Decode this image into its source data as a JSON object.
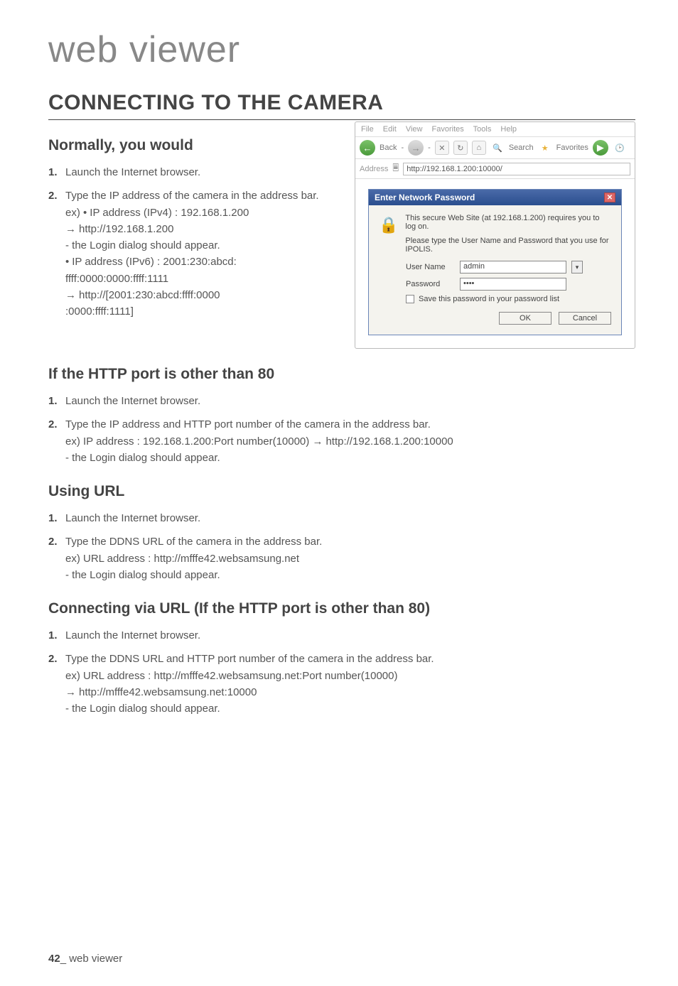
{
  "page_title": "web viewer",
  "section_title": "CONNECTING TO THE CAMERA",
  "sub1": {
    "title": "Normally, you would",
    "step1": "Launch the Internet browser.",
    "step2": "Type the IP address of the camera in the address bar.",
    "ex_a_label": "ex)",
    "ex_a_l1": "IP address (IPv4) : 192.168.1.200",
    "ex_a_l2": "http://192.168.1.200",
    "ex_a_l3": "- the Login dialog should appear.",
    "ex_a_l4": "IP address (IPv6) : 2001:230:abcd:",
    "ex_a_l5": "ffff:0000:0000:ffff:1111",
    "ex_a_l6": "http://[2001:230:abcd:ffff:0000",
    "ex_a_l7": ":0000:ffff:1111]"
  },
  "sub2": {
    "title": "If the HTTP port is other than 80",
    "step1": "Launch the Internet browser.",
    "step2": "Type the IP address and HTTP port number of the camera in the address bar.",
    "ex_label": "ex) IP address : 192.168.1.200:Port number(10000)",
    "ex_arrow": "http://192.168.1.200:10000",
    "note": "- the Login dialog should appear."
  },
  "sub3": {
    "title": "Using URL",
    "step1": "Launch the Internet browser.",
    "step2": "Type the DDNS URL of the camera in the address bar.",
    "ex": "ex) URL address : http://mfffe42.websamsung.net",
    "note": "- the Login dialog should appear."
  },
  "sub4": {
    "title": "Connecting via URL (If the HTTP port is other than 80)",
    "step1": "Launch the Internet browser.",
    "step2": "Type the DDNS URL and HTTP port number of the camera in the address bar.",
    "ex": "ex) URL address : http://mfffe42.websamsung.net:Port number(10000)",
    "arrow": "http://mfffe42.websamsung.net:10000",
    "note": "- the Login dialog should appear."
  },
  "dialog": {
    "menu": {
      "file": "File",
      "edit": "Edit",
      "view": "View",
      "favorites": "Favorites",
      "tools": "Tools",
      "help": "Help"
    },
    "toolbar": {
      "back": "Back",
      "search": "Search",
      "favorites": "Favorites"
    },
    "addr_label": "Address",
    "addr_value": "http://192.168.1.200:10000/",
    "inner_title": "Enter Network Password",
    "msg1": "This secure Web Site (at 192.168.1.200) requires you to log on.",
    "msg2": "Please type the User Name and Password that you use for IPOLIS.",
    "user_label": "User Name",
    "user_value": "admin",
    "pass_label": "Password",
    "pass_value": "••••",
    "save_label": "Save this password in your password list",
    "ok": "OK",
    "cancel": "Cancel"
  },
  "footer": {
    "page": "42",
    "sep": "_",
    "label": "web viewer"
  }
}
